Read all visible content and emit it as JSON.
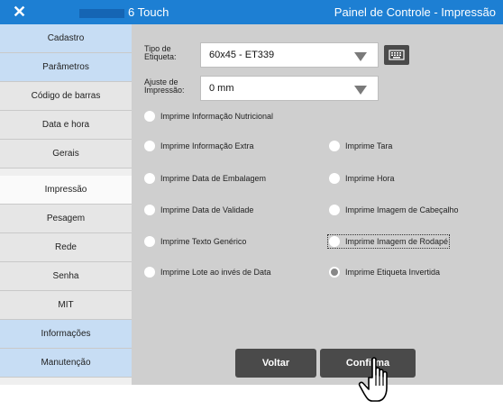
{
  "titlebar": {
    "close_glyph": "✕",
    "app_name": "6 Touch",
    "window_title": "Painel de Controle - Impressão"
  },
  "sidebar": {
    "items": [
      {
        "label": "Cadastro",
        "style": "blue"
      },
      {
        "label": "Parâmetros",
        "style": "blue"
      },
      {
        "label": "Código de barras",
        "style": "gray"
      },
      {
        "label": "Data e hora",
        "style": "gray"
      },
      {
        "label": "Gerais",
        "style": "gray"
      },
      {
        "label": "Impressão",
        "style": "active"
      },
      {
        "label": "Pesagem",
        "style": "gray"
      },
      {
        "label": "Rede",
        "style": "gray"
      },
      {
        "label": "Senha",
        "style": "gray"
      },
      {
        "label": "MIT",
        "style": "gray"
      },
      {
        "label": "Informações",
        "style": "blue"
      },
      {
        "label": "Manutenção",
        "style": "blue"
      }
    ]
  },
  "form": {
    "tipo_label_1": "Tipo de",
    "tipo_label_2": "Etiqueta:",
    "tipo_value": "60x45 - ET339",
    "ajuste_label_1": "Ajuste de",
    "ajuste_label_2": "Impressão:",
    "ajuste_value": "0 mm",
    "keyboard_icon": "keyboard-icon"
  },
  "options": {
    "nutricional": {
      "label": "Imprime Informação Nutricional",
      "checked": false
    },
    "extra": {
      "label": "Imprime Informação Extra",
      "checked": false
    },
    "tara": {
      "label": "Imprime Tara",
      "checked": false
    },
    "embalagem": {
      "label": "Imprime Data de Embalagem",
      "checked": false
    },
    "hora": {
      "label": "Imprime Hora",
      "checked": false
    },
    "validade": {
      "label": "Imprime Data de Validade",
      "checked": false
    },
    "cabecalho": {
      "label": "Imprime Imagem de Cabeçalho",
      "checked": false
    },
    "texto": {
      "label": "Imprime Texto Genérico",
      "checked": false
    },
    "rodape": {
      "label": "Imprime Imagem de Rodapé",
      "checked": false
    },
    "lote": {
      "label": "Imprime Lote ao invés de Data",
      "checked": false
    },
    "invertida": {
      "label": "Imprime Etiqueta Invertida",
      "checked": true
    }
  },
  "buttons": {
    "voltar": "Voltar",
    "confirma": "Confirma"
  },
  "colors": {
    "titlebar": "#1d7fd3",
    "panel": "#cfcfcf",
    "button": "#4a4a4a",
    "sidebar_blue": "#c7ddf4"
  },
  "icons": {
    "close": "close-icon",
    "keyboard": "keyboard-icon",
    "cursor": "hand-pointer-icon"
  }
}
